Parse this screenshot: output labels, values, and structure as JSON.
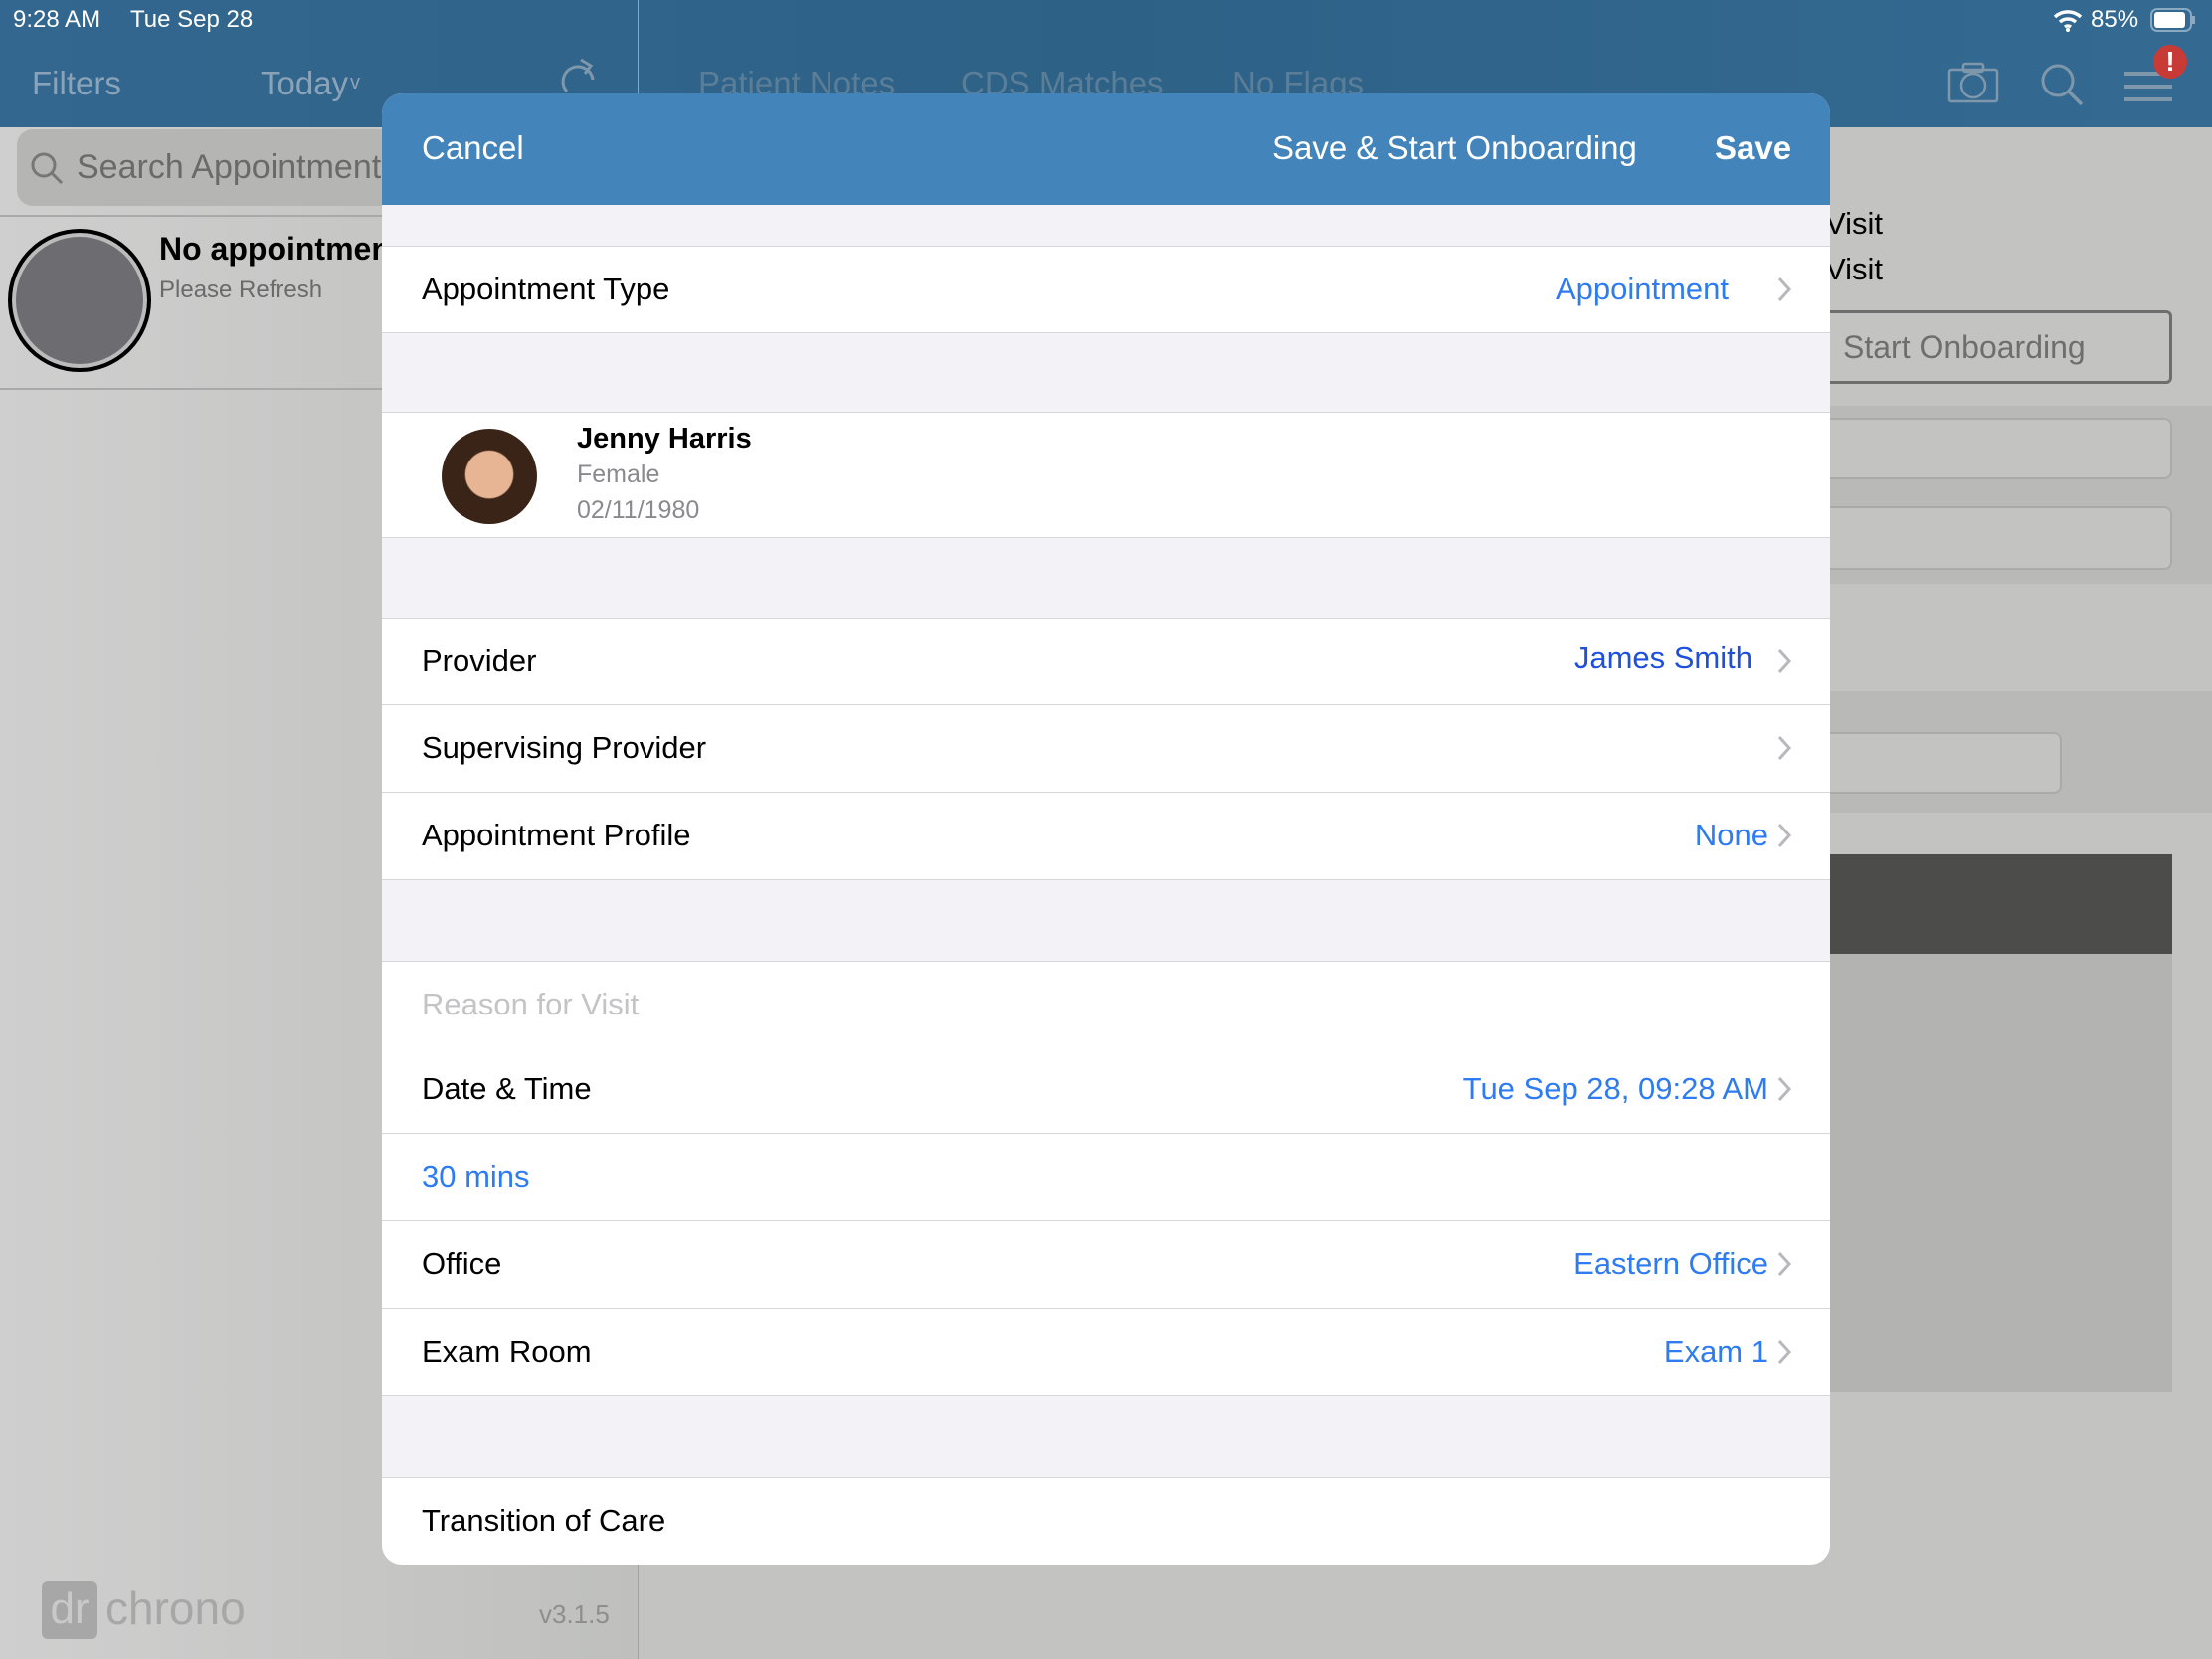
{
  "status_bar": {
    "time": "9:28 AM",
    "date": "Tue Sep 28",
    "battery": "85%"
  },
  "nav": {
    "filters": "Filters",
    "today": "Today",
    "tabs": [
      "Patient Notes",
      "CDS Matches",
      "No Flags"
    ],
    "alert_badge": "!"
  },
  "sidebar": {
    "search_placeholder": "Search Appointments",
    "empty_title": "No appointments",
    "empty_subtitle": "Please Refresh",
    "logo": "dr chrono",
    "version": "v3.1.5"
  },
  "background": {
    "visit_1": "Visit",
    "visit_2": "Visit",
    "start_onboarding": "Start Onboarding"
  },
  "modal": {
    "cancel": "Cancel",
    "save_start": "Save & Start Onboarding",
    "save": "Save",
    "appointment_type": {
      "label": "Appointment Type",
      "value": "Appointment"
    },
    "patient": {
      "name": "Jenny Harris",
      "gender": "Female",
      "dob": "02/11/1980"
    },
    "provider": {
      "label": "Provider",
      "value": "James Smith"
    },
    "supervising": {
      "label": "Supervising Provider"
    },
    "profile": {
      "label": "Appointment Profile",
      "value": "None"
    },
    "reason_placeholder": "Reason for Visit",
    "datetime": {
      "label": "Date & Time",
      "value": "Tue Sep 28, 09:28 AM"
    },
    "duration": "30 mins",
    "office": {
      "label": "Office",
      "value": "Eastern Office"
    },
    "exam_room": {
      "label": "Exam Room",
      "value": "Exam 1"
    },
    "transition": "Transition of Care"
  },
  "colors": {
    "accent": "#2e7bf3",
    "header": "#4384bb",
    "nav": "#2f6388",
    "alert": "#c83a36"
  }
}
